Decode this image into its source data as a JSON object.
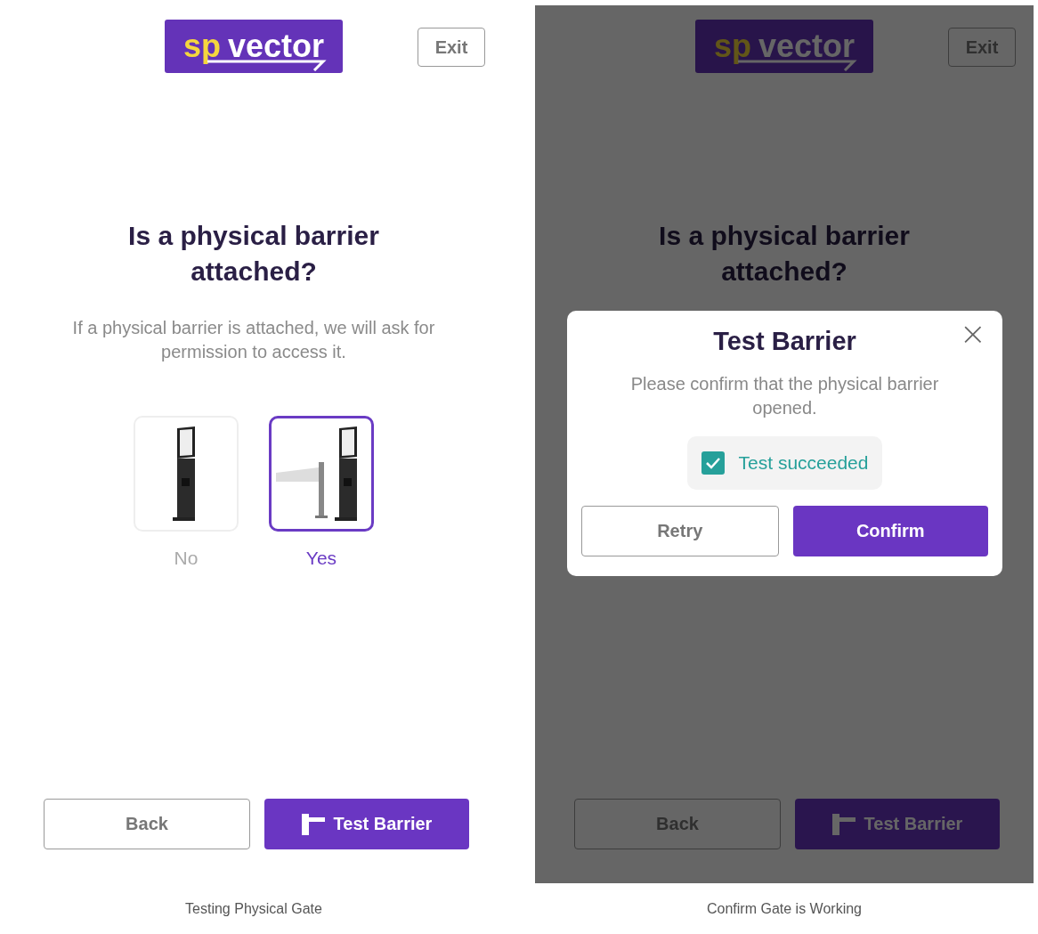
{
  "screens": [
    {
      "logo": {
        "prefix": "sp",
        "word": "vector"
      },
      "exit": "Exit",
      "title": "Is a physical barrier attached?",
      "subtitle": "If a physical barrier is attached, we will ask for permission to access it.",
      "options": [
        {
          "kind": "kiosk",
          "label": "No",
          "selected": false
        },
        {
          "kind": "barrier",
          "label": "Yes",
          "selected": true
        }
      ],
      "back": "Back",
      "test": "Test Barrier",
      "dimmed": false,
      "caption": "Testing Physical Gate"
    },
    {
      "logo": {
        "prefix": "sp",
        "word": "vector"
      },
      "exit": "Exit",
      "title": "Is a physical barrier attached?",
      "back": "Back",
      "test": "Test Barrier",
      "dimmed": true,
      "dialog": {
        "title": "Test Barrier",
        "close": "×",
        "text": "Please confirm that the physical barrier opened.",
        "check": {
          "label": "Test succeeded",
          "checked": true
        },
        "retry": "Retry",
        "confirm": "Confirm"
      },
      "caption": "Confirm Gate is Working"
    }
  ]
}
